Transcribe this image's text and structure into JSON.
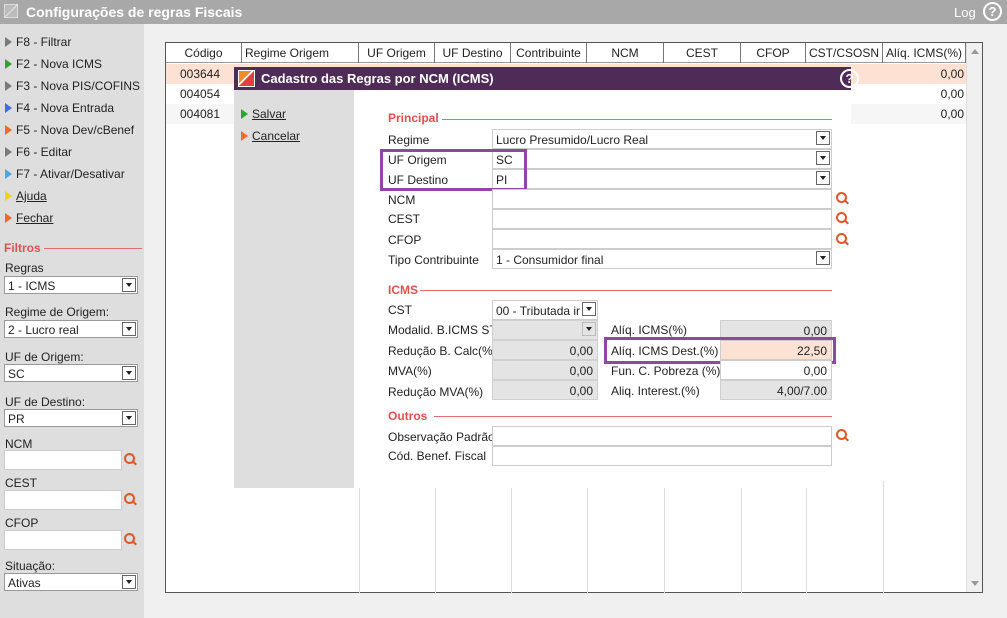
{
  "window": {
    "title": "Configurações de regras Fiscais",
    "log_label": "Log",
    "help_label": "?"
  },
  "sidebar": {
    "shortcuts": [
      {
        "label": "F8 - Filtrar",
        "color": "gray"
      },
      {
        "label": "F2 - Nova ICMS",
        "color": "green"
      },
      {
        "label": "F3 - Nova PIS/COFINS",
        "color": "gray"
      },
      {
        "label": "F4 - Nova Entrada",
        "color": "blue"
      },
      {
        "label": "F5 - Nova Dev/cBenef",
        "color": "orange"
      },
      {
        "label": "F6 - Editar",
        "color": "gray"
      },
      {
        "label": "F7 - Ativar/Desativar",
        "color": "lblue"
      },
      {
        "label": "Ajuda",
        "color": "yellow"
      },
      {
        "label": "Fechar",
        "color": "orange"
      }
    ],
    "filtros_title": "Filtros",
    "regras": {
      "label": "Regras",
      "value": "1 - ICMS"
    },
    "regime_origem": {
      "label": "Regime de Origem:",
      "value": "2 - Lucro real"
    },
    "uf_origem": {
      "label": "UF de Origem:",
      "value": "SC"
    },
    "uf_destino": {
      "label": "UF de Destino:",
      "value": "PR"
    },
    "ncm": {
      "label": "NCM",
      "value": ""
    },
    "cest": {
      "label": "CEST",
      "value": ""
    },
    "cfop": {
      "label": "CFOP",
      "value": ""
    },
    "situacao": {
      "label": "Situação:",
      "value": "Ativas"
    }
  },
  "grid": {
    "columns": [
      "Código",
      "Regime Origem",
      "UF Origem",
      "UF Destino",
      "Contribuinte",
      "NCM",
      "CEST",
      "CFOP",
      "CST/CSOSN",
      "Alíq. ICMS(%)"
    ],
    "rows": [
      {
        "codigo": "003644",
        "aliq": "0,00"
      },
      {
        "codigo": "004054",
        "aliq": "0,00"
      },
      {
        "codigo": "004081",
        "aliq": "0,00"
      }
    ]
  },
  "modal": {
    "title": "Cadastro das Regras por NCM (ICMS)",
    "salvar": "Salvar",
    "cancelar": "Cancelar",
    "principal": {
      "title": "Principal",
      "regime_label": "Regime",
      "regime_value": "Lucro Presumido/Lucro Real",
      "uf_origem_label": "UF Origem",
      "uf_origem_value": "SC",
      "uf_destino_label": "UF Destino",
      "uf_destino_value": "PI",
      "ncm_label": "NCM",
      "ncm_value": "",
      "cest_label": "CEST",
      "cest_value": "",
      "cfop_label": "CFOP",
      "cfop_value": "",
      "tipo_label": "Tipo Contribuinte",
      "tipo_value": "1 - Consumidor final"
    },
    "icms": {
      "title": "ICMS",
      "cst_label": "CST",
      "cst_value": "00 - Tributada ir",
      "modalid_label": "Modalid. B.ICMS ST",
      "modalid_value": "",
      "aliq_icms_label": "Alíq. ICMS(%)",
      "aliq_icms_value": "0,00",
      "reducao_label": "Redução B. Calc(%)",
      "reducao_value": "0,00",
      "aliq_dest_label": "Alíq. ICMS Dest.(%)",
      "aliq_dest_value": "22,50",
      "mva_label": "MVA(%)",
      "mva_value": "0,00",
      "fun_label": "Fun. C. Pobreza (%)",
      "fun_value": "0,00",
      "reducao_mva_label": "Redução MVA(%)",
      "reducao_mva_value": "0,00",
      "aliq_inter_label": "Aliq. Interest.(%)",
      "aliq_inter_value": "4,00/7.00"
    },
    "outros": {
      "title": "Outros",
      "obs_label": "Observação Padrão",
      "obs_value": "",
      "cod_label": "Cód. Benef. Fiscal",
      "cod_value": ""
    }
  }
}
